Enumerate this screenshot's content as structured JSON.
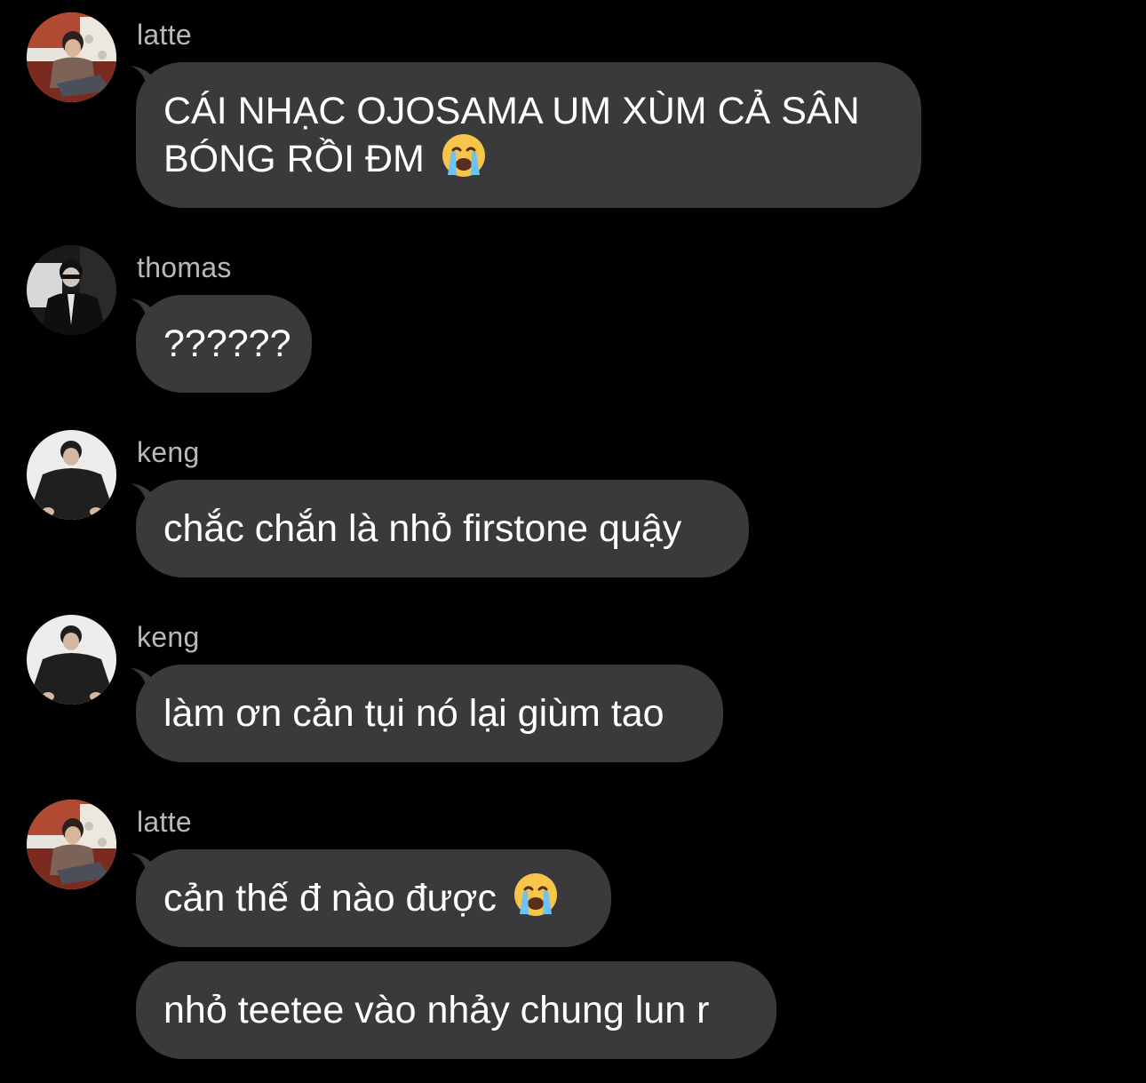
{
  "messages": [
    {
      "sender": "latte",
      "avatar": "latte-avatar",
      "text_line1": "CÁI NHẠC OJOSAMA UM XÙM CẢ SÂN",
      "text_line2": "BÓNG RỒI ĐM",
      "emoji": "loudly-crying-face-icon"
    },
    {
      "sender": "thomas",
      "avatar": "thomas-avatar",
      "text": "??????"
    },
    {
      "sender": "keng",
      "avatar": "keng-avatar",
      "text": "chắc chắn là nhỏ firstone quậy"
    },
    {
      "sender": "keng",
      "avatar": "keng-avatar",
      "text": "làm ơn cản tụi nó lại giùm tao"
    },
    {
      "sender": "latte",
      "avatar": "latte-avatar",
      "text": "cản thế đ nào được",
      "emoji": "loudly-crying-face-icon"
    },
    {
      "sender": "latte",
      "text": "nhỏ teetee vào nhảy chung lun r"
    }
  ],
  "colors": {
    "background": "#000000",
    "bubble": "#3a3a3c",
    "username": "#b9b9b9",
    "text": "#ffffff"
  }
}
